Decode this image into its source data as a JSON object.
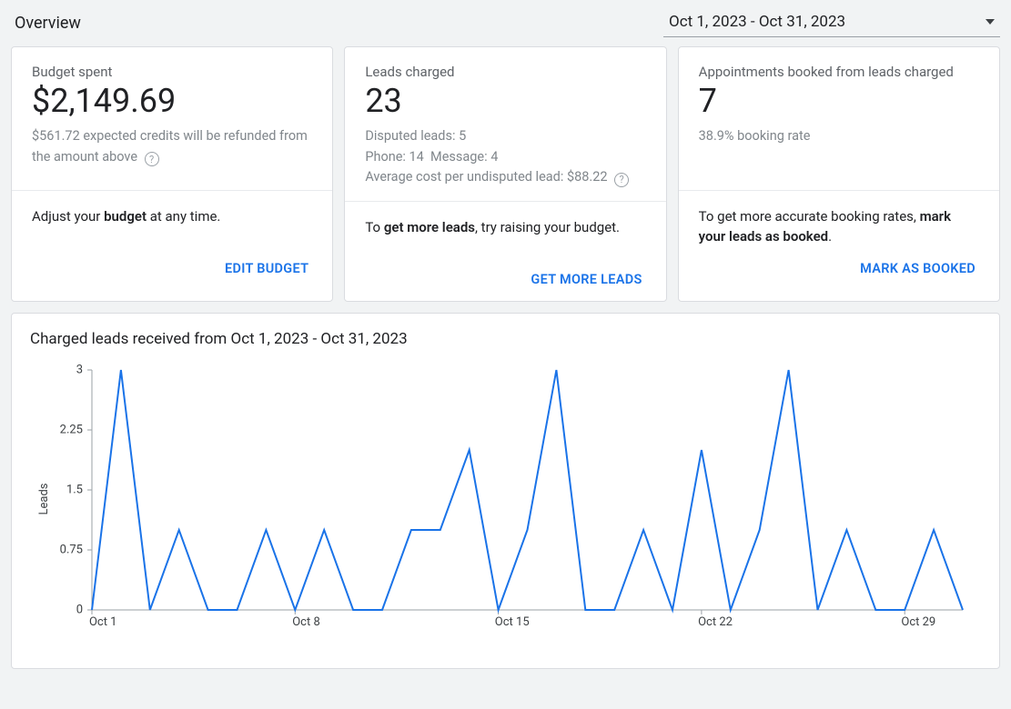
{
  "header": {
    "title": "Overview",
    "date_range": "Oct 1, 2023 - Oct 31, 2023"
  },
  "cards": {
    "budget": {
      "label": "Budget spent",
      "metric": "$2,149.69",
      "desc": "$561.72 expected credits will be refunded from the amount above",
      "hint_pre": "Adjust your ",
      "hint_strong": "budget",
      "hint_post": " at any time.",
      "action": "EDIT BUDGET"
    },
    "leads": {
      "label": "Leads charged",
      "metric": "23",
      "disputed": "Disputed leads: 5",
      "phone": "Phone: 14",
      "message": "Message: 4",
      "avg": "Average cost per undisputed lead: $88.22",
      "hint_pre": "To ",
      "hint_strong": "get more leads",
      "hint_post": ", try raising your budget.",
      "action": "GET MORE LEADS"
    },
    "appointments": {
      "label": "Appointments booked from leads charged",
      "metric": "7",
      "desc": "38.9% booking rate",
      "hint_pre": "To get more accurate booking rates, ",
      "hint_strong": "mark your leads as booked",
      "hint_post": ".",
      "action": "MARK AS BOOKED"
    }
  },
  "chart_title": "Charged leads received from Oct 1, 2023 - Oct 31, 2023",
  "chart_data": {
    "type": "line",
    "ylabel": "Leads",
    "xlabel": "",
    "ylim": [
      0,
      3
    ],
    "y_ticks": [
      0,
      0.75,
      1.5,
      2.25,
      3
    ],
    "x_tick_labels": [
      "Oct 1",
      "Oct 8",
      "Oct 15",
      "Oct 22",
      "Oct 29"
    ],
    "x_tick_indices": [
      0,
      7,
      14,
      21,
      28
    ],
    "categories": [
      "Oct 1",
      "Oct 2",
      "Oct 3",
      "Oct 4",
      "Oct 5",
      "Oct 6",
      "Oct 7",
      "Oct 8",
      "Oct 9",
      "Oct 10",
      "Oct 11",
      "Oct 12",
      "Oct 13",
      "Oct 14",
      "Oct 15",
      "Oct 16",
      "Oct 17",
      "Oct 18",
      "Oct 19",
      "Oct 20",
      "Oct 21",
      "Oct 22",
      "Oct 23",
      "Oct 24",
      "Oct 25",
      "Oct 26",
      "Oct 27",
      "Oct 28",
      "Oct 29",
      "Oct 30",
      "Oct 31"
    ],
    "values": [
      0,
      3,
      0,
      1,
      0,
      0,
      1,
      0,
      1,
      0,
      0,
      1,
      1,
      2,
      0,
      1,
      3,
      0,
      0,
      1,
      0,
      2,
      0,
      1,
      3,
      0,
      1,
      0,
      0,
      1,
      0
    ]
  }
}
